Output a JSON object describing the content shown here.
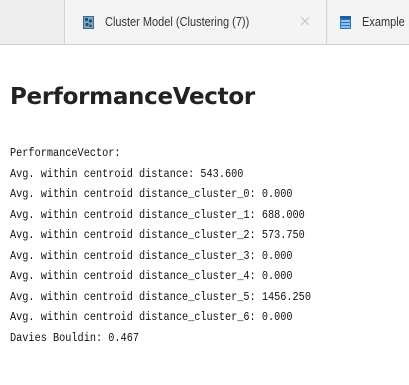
{
  "tabs": [
    {
      "label": "Cluster Model (Clustering (7))",
      "icon": "cluster-model-icon",
      "close_icon": "close-icon",
      "active": false
    },
    {
      "label": "Example",
      "icon": "example-set-icon",
      "active": false
    }
  ],
  "result": {
    "title": "PerformanceVector",
    "lines": [
      "PerformanceVector:",
      "Avg. within centroid distance: 543.600",
      "Avg. within centroid distance_cluster_0: 0.000",
      "Avg. within centroid distance_cluster_1: 688.000",
      "Avg. within centroid distance_cluster_2: 573.750",
      "Avg. within centroid distance_cluster_3: 0.000",
      "Avg. within centroid distance_cluster_4: 0.000",
      "Avg. within centroid distance_cluster_5: 1456.250",
      "Avg. within centroid distance_cluster_6: 0.000",
      "Davies Bouldin: 0.467"
    ]
  },
  "colors": {
    "tab_bar": "#eeeeee",
    "title_text": "#222222",
    "body_text": "#111111"
  }
}
